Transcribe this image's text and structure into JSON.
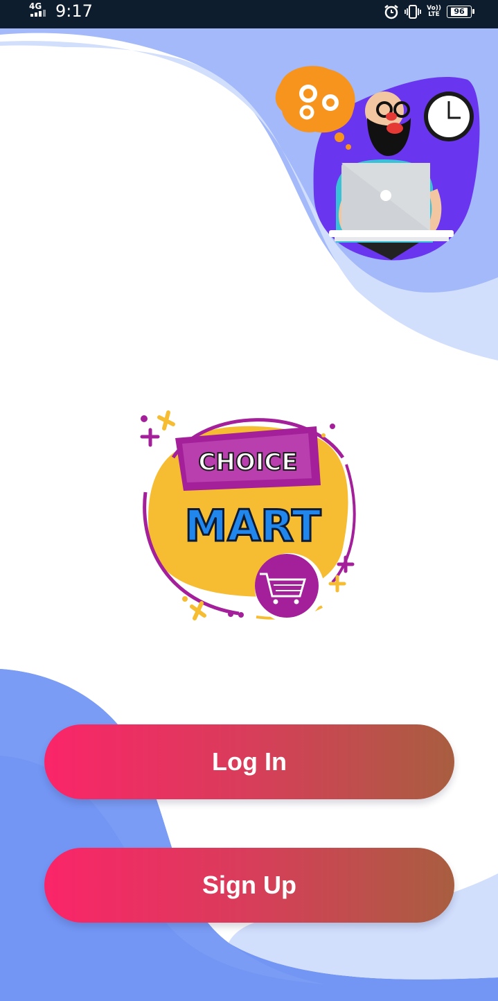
{
  "status_bar": {
    "network": "4G",
    "time": "9:17",
    "volte_line1": "Vo))",
    "volte_line2": "LTE",
    "battery": "96",
    "icons": [
      "alarm-icon",
      "vibrate-icon",
      "volte-icon",
      "battery-icon",
      "signal-icon"
    ]
  },
  "logo": {
    "line1": "CHOICE",
    "line2": "MART"
  },
  "buttons": {
    "login_label": "Log In",
    "signup_label": "Sign Up"
  },
  "colors": {
    "status_bar": "#0d1d2e",
    "wave_light": "#d1defc",
    "wave_mid": "#a3b9f9",
    "wave_dark": "#7396f5",
    "button_start": "#fa2569",
    "button_end": "#a85e40",
    "logo_yellow": "#f6bd33",
    "logo_purple": "#a3209a",
    "logo_blue": "#2287ec"
  }
}
